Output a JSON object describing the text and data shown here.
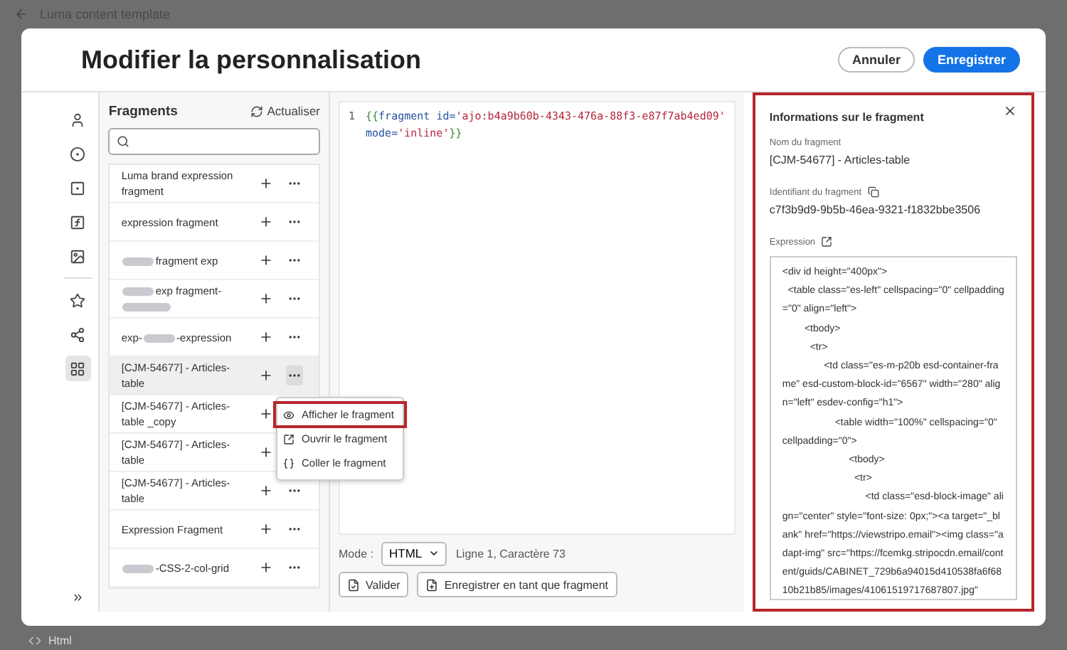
{
  "background": {
    "title": "Luma content template",
    "footer_label": "Html"
  },
  "dialog": {
    "title": "Modifier la personnalisation",
    "buttons": [
      {
        "label": "Annuler",
        "kind": "secondary"
      },
      {
        "label": "Enregistrer",
        "kind": "primary"
      }
    ]
  },
  "rail": [
    {
      "kind": "user",
      "selected": false
    },
    {
      "kind": "badge",
      "selected": false
    },
    {
      "kind": "square",
      "selected": false
    },
    {
      "kind": "function",
      "selected": false
    },
    {
      "kind": "image",
      "selected": false
    },
    {
      "kind": "star",
      "selected": false
    },
    {
      "kind": "share",
      "selected": false
    },
    {
      "kind": "grid",
      "selected": true
    }
  ],
  "rail_expand": "»",
  "fragments": {
    "title": "Fragments",
    "refresh": "Actualiser",
    "items": [
      {
        "name": "Luma brand expression fragment",
        "selected": false
      },
      {
        "name": "expression fragment",
        "selected": false
      },
      {
        "redacted_after": "fragment exp",
        "selected": false
      },
      {
        "redacted_after": "exp fragment-",
        "redacted_tail": true,
        "selected": false
      },
      {
        "redacted_before": "exp-",
        "redacted_after": "-expression",
        "selected": false
      },
      {
        "name": "[CJM-54677] - Articles-table",
        "selected": true
      },
      {
        "name": "[CJM-54677] - Articles-table _copy",
        "selected": false,
        "more_covered": true
      },
      {
        "name": "[CJM-54677] - Articles-table",
        "selected": false,
        "more_covered": true
      },
      {
        "name": "[CJM-54677] - Articles-table",
        "selected": false
      },
      {
        "name": "Expression Fragment",
        "selected": false
      },
      {
        "redacted_after": "-CSS-2-col-grid",
        "selected": false
      }
    ]
  },
  "context_menu": [
    {
      "label": "Afficher le fragment",
      "kind": "view",
      "annotated": true
    },
    {
      "label": "Ouvrir le fragment",
      "kind": "open",
      "annotated": false
    },
    {
      "label": "Coller le fragment",
      "kind": "paste",
      "annotated": false
    }
  ],
  "editor": {
    "lines": [
      {
        "number": "1",
        "tokens": [
          {
            "text": "{{",
            "kind": "punct"
          },
          {
            "text": "fragment ",
            "kind": "keyword"
          },
          {
            "text": "id=",
            "kind": "attr"
          },
          {
            "text": "'ajo:b4a9b60b-4343-476a-88f3-e87f7ab4ed09'",
            "kind": "string"
          }
        ]
      },
      {
        "tokens": [
          {
            "text": "mode=",
            "kind": "attr"
          },
          {
            "text": "'inline'",
            "kind": "string"
          },
          {
            "text": "}}",
            "kind": "punct"
          }
        ]
      }
    ],
    "mode_label": "Mode :",
    "mode": "HTML",
    "position": "Ligne 1, Caractère 73",
    "validate": "Valider",
    "save_as_fragment": "Enregistrer en tant que fragment"
  },
  "info_panel": {
    "annotated": true,
    "title": "Informations sur le fragment",
    "name_label": "Nom du fragment",
    "name": "[CJM-54677] - Articles-table",
    "id_label": "Identifiant du fragment",
    "id": "c7f3b9d9-9b5b-46ea-9321-f1832bbe3506",
    "expression_label": "Expression",
    "expression": "<div id height=\"400px\">\n  <table class=\"es-left\" cellspacing=\"0\" cellpadding=\"0\" align=\"left\">\n        <tbody>\n          <tr>\n               <td class=\"es-m-p20b esd-container-frame\" esd-custom-block-id=\"6567\" width=\"280\" align=\"left\" esdev-config=\"h1\">\n                   <table width=\"100%\" cellspacing=\"0\" cellpadding=\"0\">\n                        <tbody>\n                          <tr>\n                              <td class=\"esd-block-image\" align=\"center\" style=\"font-size: 0px;\"><a target=\"_blank\" href=\"https://viewstripo.email\"><img class=\"adapt-img\" src=\"https://fcemkg.stripocdn.email/content/guids/CABINET_729b6a94015d410538fa6f6810b21b85/images/41061519717687807.jpg\""
  }
}
